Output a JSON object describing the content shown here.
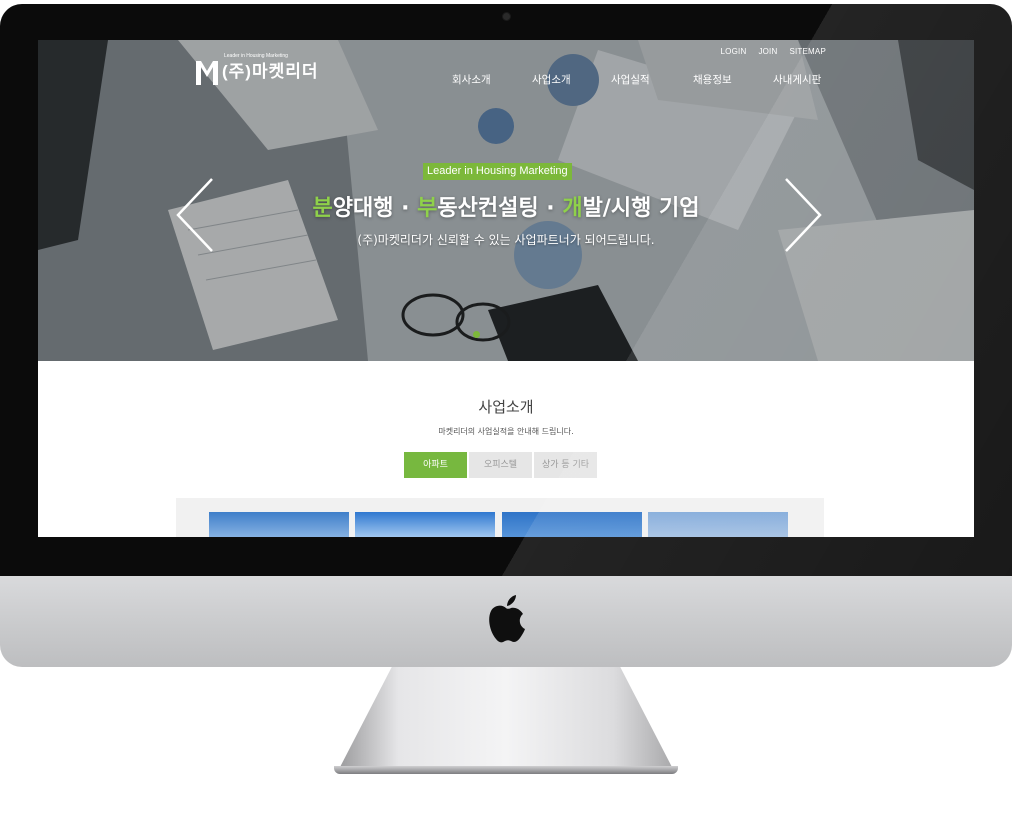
{
  "header": {
    "logo_tagline": "Leader in Housing Marketing",
    "logo_name": "(주)마켓리더",
    "top_links": [
      "LOGIN",
      "JOIN",
      "SITEMAP"
    ],
    "nav": [
      "회사소개",
      "사업소개",
      "사업실적",
      "채용정보",
      "사내게시판"
    ]
  },
  "hero": {
    "badge": "Leader in Housing Marketing",
    "title_parts": [
      {
        "text": "분",
        "accent": true
      },
      {
        "text": "양대행 · ",
        "accent": false
      },
      {
        "text": "부",
        "accent": true
      },
      {
        "text": "동산컨설팅 · ",
        "accent": false
      },
      {
        "text": "개",
        "accent": true
      },
      {
        "text": "발/시행 기업",
        "accent": false
      }
    ],
    "subtitle": "(주)마켓리더가 신뢰할 수 있는 사업파트너가 되어드립니다.",
    "prev_icon": "chevron-left-icon",
    "next_icon": "chevron-right-icon"
  },
  "section": {
    "title": "사업소개",
    "description": "마켓리더의 사업실적을 안내해 드립니다.",
    "tabs": [
      {
        "label": "아파트",
        "active": true
      },
      {
        "label": "오피스텔",
        "active": false
      },
      {
        "label": "상가 등 기타",
        "active": false
      }
    ]
  },
  "colors": {
    "accent_green": "#7cb83a",
    "bezel": "#0b0b0b",
    "chin": "#c9cacc"
  }
}
